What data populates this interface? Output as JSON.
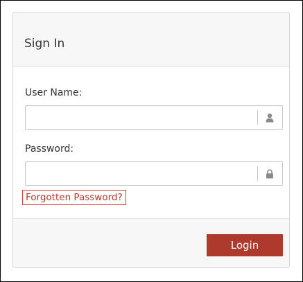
{
  "panel": {
    "title": "Sign In"
  },
  "form": {
    "username_label": "User Name:",
    "username_value": "",
    "password_label": "Password:",
    "password_value": "",
    "forgot_link": "Forgotten Password?",
    "login_label": "Login"
  },
  "icons": {
    "username": "user-icon",
    "password": "lock-icon"
  },
  "colors": {
    "primary_button": "#ad3a2d",
    "link": "#b0392e",
    "focus_outline": "#e03c3c",
    "icon": "#8a8a8a"
  }
}
